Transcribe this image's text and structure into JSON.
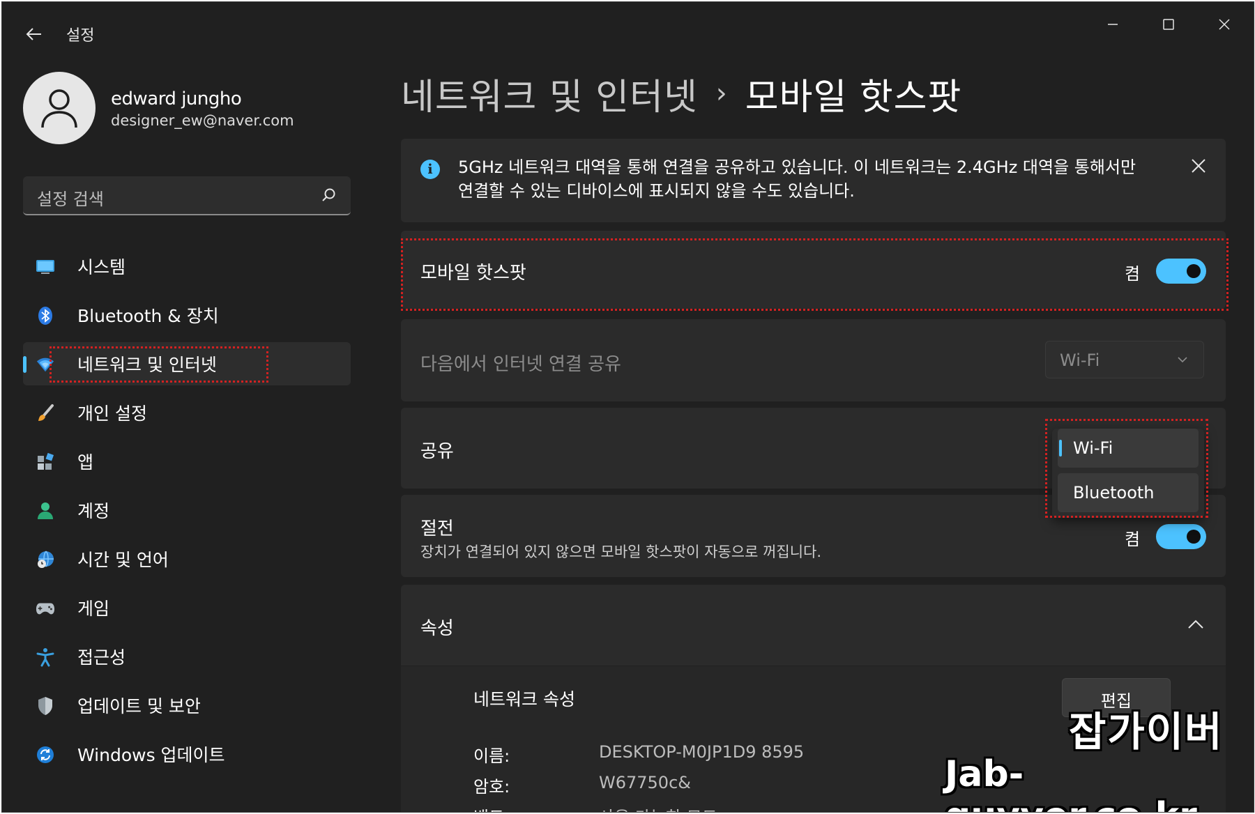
{
  "window": {
    "title": "설정"
  },
  "user": {
    "name": "edward jungho",
    "email": "designer_ew@naver.com"
  },
  "search": {
    "placeholder": "설정 검색"
  },
  "sidebar": {
    "items": [
      {
        "label": "시스템",
        "icon": "monitor-icon"
      },
      {
        "label": "Bluetooth & 장치",
        "icon": "bluetooth-icon"
      },
      {
        "label": "네트워크 및 인터넷",
        "icon": "network-icon",
        "active": true
      },
      {
        "label": "개인 설정",
        "icon": "brush-icon"
      },
      {
        "label": "앱",
        "icon": "apps-icon"
      },
      {
        "label": "계정",
        "icon": "person-icon"
      },
      {
        "label": "시간 및 언어",
        "icon": "globe-clock-icon"
      },
      {
        "label": "게임",
        "icon": "gamepad-icon"
      },
      {
        "label": "접근성",
        "icon": "accessibility-icon"
      },
      {
        "label": "업데이트 및 보안",
        "icon": "shield-icon"
      },
      {
        "label": "Windows 업데이트",
        "icon": "sync-icon"
      }
    ]
  },
  "breadcrumb": {
    "parent": "네트워크 및 인터넷",
    "separator": "›",
    "current": "모바일 핫스팟"
  },
  "info": {
    "text": "5GHz 네트워크 대역을 통해 연결을 공유하고 있습니다. 이 네트워크는 2.4GHz 대역을 통해서만 연결할 수 있는 디바이스에 표시되지 않을 수도 있습니다."
  },
  "hotspot": {
    "label": "모바일 핫스팟",
    "state": "켬"
  },
  "share_from": {
    "label": "다음에서 인터넷 연결 공유",
    "value": "Wi-Fi"
  },
  "share_over": {
    "label": "공유",
    "options": [
      "Wi-Fi",
      "Bluetooth"
    ],
    "selected": "Wi-Fi"
  },
  "power_saving": {
    "label": "절전",
    "description": "장치가 연결되어 있지 않으면 모바일 핫스팟이 자동으로 꺼집니다.",
    "state": "켬"
  },
  "properties": {
    "label": "속성",
    "network_props_label": "네트워크 속성",
    "edit_label": "편집",
    "name_key": "이름:",
    "name_value": "DESKTOP-M0JP1D9 8595",
    "password_key": "암호:",
    "password_value": "W67750c&",
    "band_key": "밴드:",
    "band_value": "사용 가능한 모드"
  },
  "watermark": {
    "title": "잡가이버",
    "url": "Jab-guyver.co.kr"
  },
  "colors": {
    "accent": "#4cc2ff",
    "background": "#202020",
    "card": "#2b2b2b",
    "highlight": "#d32121"
  }
}
